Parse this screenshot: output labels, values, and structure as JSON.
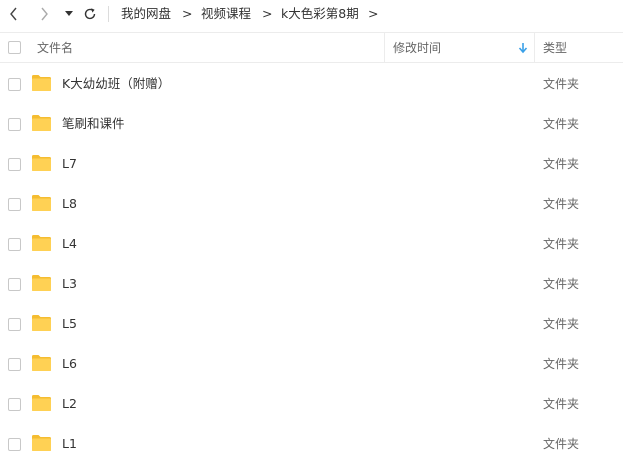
{
  "breadcrumb": {
    "items": [
      "我的网盘",
      "视频课程",
      "k大色彩第8期"
    ],
    "separator": ">"
  },
  "table": {
    "headers": {
      "name": "文件名",
      "modified": "修改时间",
      "type": "类型"
    },
    "sort": {
      "column": "modified",
      "direction": "down"
    },
    "rows": [
      {
        "name": "K大幼幼班（附赠）",
        "type": "文件夹"
      },
      {
        "name": "笔刷和课件",
        "type": "文件夹"
      },
      {
        "name": "L7",
        "type": "文件夹"
      },
      {
        "name": "L8",
        "type": "文件夹"
      },
      {
        "name": "L4",
        "type": "文件夹"
      },
      {
        "name": "L3",
        "type": "文件夹"
      },
      {
        "name": "L5",
        "type": "文件夹"
      },
      {
        "name": "L6",
        "type": "文件夹"
      },
      {
        "name": "L2",
        "type": "文件夹"
      },
      {
        "name": "L1",
        "type": "文件夹"
      }
    ]
  },
  "colors": {
    "folder": "#ffd154",
    "folder_tab": "#f5bd31",
    "sort_arrow": "#3aa0e8",
    "text": "#333333",
    "muted": "#666666"
  },
  "icons": {
    "back": "chevron-left-icon",
    "forward": "chevron-right-icon",
    "history": "caret-down-icon",
    "refresh": "refresh-icon",
    "folder": "folder-icon",
    "sort": "arrow-down-icon"
  }
}
